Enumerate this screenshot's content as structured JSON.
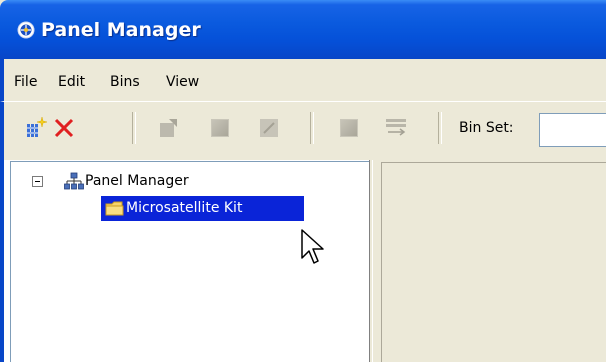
{
  "window": {
    "title": "Panel Manager"
  },
  "menu": {
    "items": [
      "File",
      "Edit",
      "Bins",
      "View"
    ]
  },
  "toolbar": {
    "binset_label": "Bin Set:",
    "binset_value": ""
  },
  "tree": {
    "root_label": "Panel Manager",
    "root_expanded": true,
    "children": [
      {
        "label": "Microsatellite Kit",
        "selected": true
      }
    ]
  },
  "colors": {
    "titlebar": "#0a5ade",
    "selection": "#0a24d8",
    "delete": "#e02020"
  }
}
